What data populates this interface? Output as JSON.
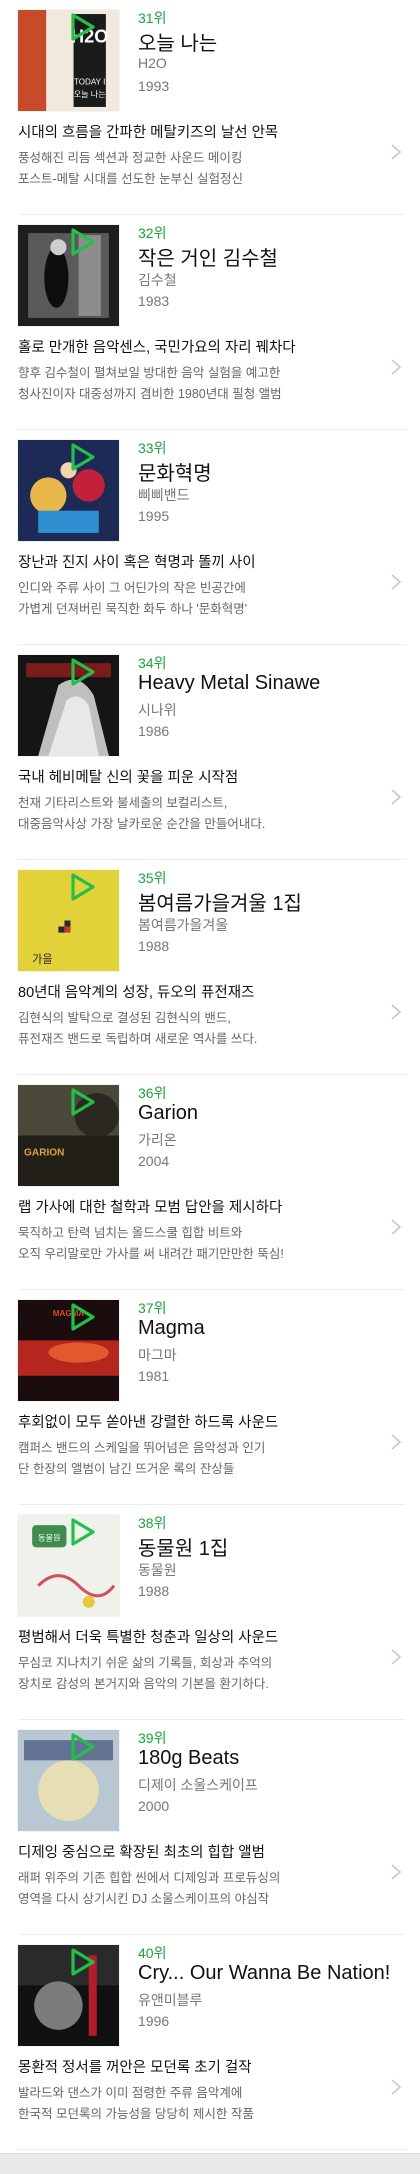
{
  "albums": [
    {
      "rank": "31위",
      "title": "오늘 나는",
      "artist": "H2O",
      "year": "1993",
      "headline": "시대의 흐름을 간파한 메탈키즈의 날선 안목",
      "desc1": "풍성해진 리듬 섹션과 정교한 사운드 메이킹",
      "desc2": "포스트-메탈 시대를 선도한 눈부신 실험정신",
      "cover_colors": [
        "#e9e4dc",
        "#1b1b1b",
        "#c8262a"
      ]
    },
    {
      "rank": "32위",
      "title": "작은 거인 김수철",
      "artist": "김수철",
      "year": "1983",
      "headline": "홀로 만개한 음악센스, 국민가요의 자리 꿰차다",
      "desc1": "향후 김수철이 펼쳐보일 방대한 음악 실험을 예고한",
      "desc2": "청사진이자 대중성까지 겸비한 1980년대 필청 앨범",
      "cover_colors": [
        "#2a2a2a",
        "#7d7d7d",
        "#cfcfcf"
      ]
    },
    {
      "rank": "33위",
      "title": "문화혁명",
      "artist": "삐삐밴드",
      "year": "1995",
      "headline": "장난과 진지 사이 혹은 혁명과 똘끼 사이",
      "desc1": "인디와 주류 사이 그 어딘가의 작은 빈공간에",
      "desc2": "가볍게 던져버린 묵직한 화두 하나 '문화혁명'",
      "cover_colors": [
        "#1d2a56",
        "#c2203b",
        "#2f8fd1"
      ]
    },
    {
      "rank": "34위",
      "title": "Heavy Metal Sinawe",
      "artist": "시나위",
      "year": "1986",
      "headline": "국내 헤비메탈 신의 꽃을 피운 시작점",
      "desc1": "천재 기타리스트와 불세출의 보컬리스트,",
      "desc2": "대중음악사상 가장 날카로운 순간을 만들어내다.",
      "cover_colors": [
        "#151515",
        "#d9d9d9",
        "#7a1c1c"
      ]
    },
    {
      "rank": "35위",
      "title": "봄여름가을겨울 1집",
      "artist": "봄여름가을겨울",
      "year": "1988",
      "headline": "80년대 음악계의 성장, 듀오의 퓨전재즈",
      "desc1": "김현식의 발탁으로 결성된 김현식의 밴드,",
      "desc2": "퓨전재즈 밴드로 독립하며 새로운 역사를 쓰다.",
      "cover_colors": [
        "#e3d13a",
        "#c23a2a",
        "#2a2a2a"
      ]
    },
    {
      "rank": "36위",
      "title": "Garion",
      "artist": "가리온",
      "year": "2004",
      "headline": "랩 가사에 대한 철학과 모범 답안을 제시하다",
      "desc1": "묵직하고 탄력 넘치는 올드스쿨 힙합 비트와",
      "desc2": "오직 우리말로만 가사를 써 내려간 패기만만한 뚝심!",
      "cover_colors": [
        "#3b3a2e",
        "#d9a441",
        "#1a1a14"
      ]
    },
    {
      "rank": "37위",
      "title": "Magma",
      "artist": "마그마",
      "year": "1981",
      "headline": "후회없이 모두 쏟아낸 강렬한 하드록 사운드",
      "desc1": "캠퍼스 밴드의 스케일을 뛰어넘은 음악성과 인기",
      "desc2": "단 한장의 앨범이 남긴 뜨거운 록의 잔상들",
      "cover_colors": [
        "#1b0d0d",
        "#b5261e",
        "#e2582f"
      ]
    },
    {
      "rank": "38위",
      "title": "동물원 1집",
      "artist": "동물원",
      "year": "1988",
      "headline": "평범해서 더욱 특별한 청춘과 일상의 사운드",
      "desc1": "무심코 지나치기 쉬운 삶의 기록들, 회상과 추억의",
      "desc2": "장치로 감성의 본거지와 음악의 기본을 환기하다.",
      "cover_colors": [
        "#f1f1ec",
        "#3e8d4e",
        "#d04f62"
      ]
    },
    {
      "rank": "39위",
      "title": "180g Beats",
      "artist": "디제이 소울스케이프",
      "year": "2000",
      "headline": "디제잉 중심으로 확장된 최초의 힙합 앨범",
      "desc1": "래퍼 위주의 기존 힙합 씬에서 디제잉과 프로듀싱의",
      "desc2": "영역을 다시 상기시킨 DJ 소울스케이프의 야심작",
      "cover_colors": [
        "#b9c7d3",
        "#e7dfb4",
        "#3c4f76"
      ]
    },
    {
      "rank": "40위",
      "title": "Cry... Our Wanna Be Nation!",
      "artist": "유앤미블루",
      "year": "1996",
      "headline": "몽환적 정서를 꺼안은 모던록 초기 걸작",
      "desc1": "발라드와 댄스가 이미 점령한 주류 음악계에",
      "desc2": "한국적 모던록의 가능성을 당당히 제시한 작품",
      "cover_colors": [
        "#111111",
        "#7c7c7c",
        "#b31c2a"
      ]
    }
  ],
  "cover_text": {
    "h2o_logo": "H2O",
    "h2o_sub1": "TODAY I",
    "h2o_sub2": "오늘 나는",
    "garion": "GARION",
    "magma": "MAGMA",
    "dongmulwon": "동물원",
    "bom": "가을"
  },
  "icons": {
    "play": "play-icon",
    "chevron": "chevron-right-icon"
  },
  "accent_color": "#1aa33a"
}
